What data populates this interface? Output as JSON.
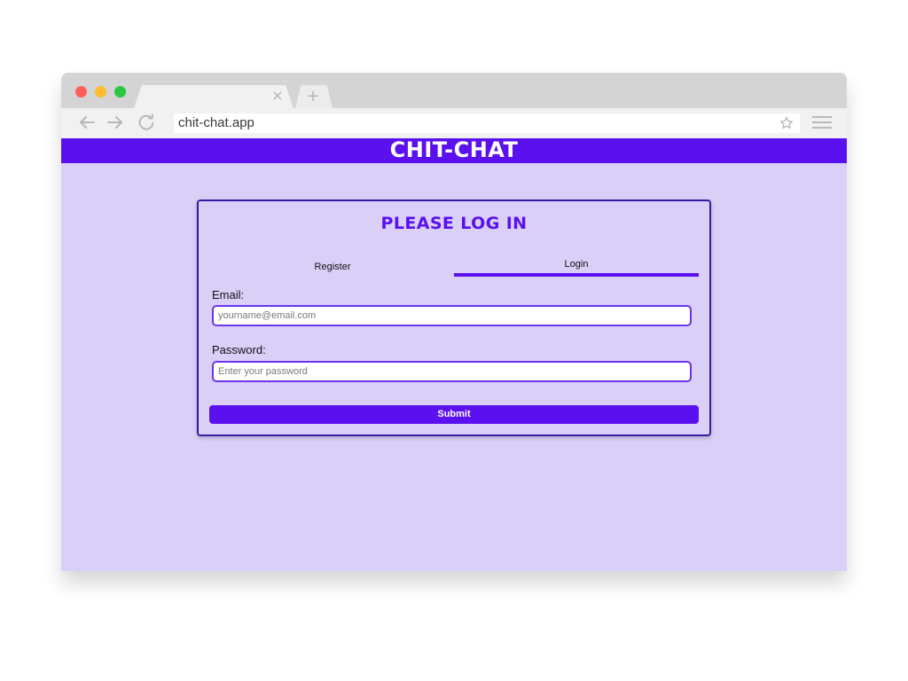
{
  "browser": {
    "url": "chit-chat.app",
    "tab_close_glyph": "×",
    "new_tab_glyph": "+",
    "icons": {
      "back": "arrow-left-icon",
      "forward": "arrow-right-icon",
      "reload": "reload-icon",
      "bookmark": "star-icon",
      "menu": "hamburger-menu-icon",
      "close_tab": "close-icon",
      "new_tab": "plus-icon"
    },
    "colors": {
      "chrome": "#d4d4d4",
      "toolbar": "#f1f1f1",
      "close": "#ff5f57",
      "minimize": "#febc2e",
      "maximize": "#28c840"
    }
  },
  "site": {
    "title": "Chit-Chat",
    "colors": {
      "accent": "#5a10ef",
      "background": "#d9cff7",
      "card_border": "#3b1aa3",
      "text": "#111111"
    }
  },
  "login": {
    "heading": "Please Log In",
    "tabs": [
      {
        "label": "Register",
        "active": false
      },
      {
        "label": "Login",
        "active": true
      }
    ],
    "email": {
      "label": "Email:",
      "placeholder": "yourname@email.com",
      "value": ""
    },
    "password": {
      "label": "Password:",
      "placeholder": "Enter your password",
      "value": ""
    },
    "submit_label": "Submit"
  }
}
